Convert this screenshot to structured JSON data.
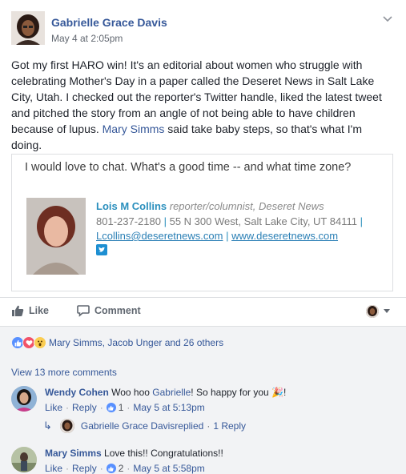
{
  "post": {
    "author": "Gabrielle Grace Davis",
    "timestamp": "May 4 at 2:05pm",
    "text_before_mention": "Got my first HARO win! It's an editorial about women who struggle with celebrating Mother's Day in a paper called the Deseret News in Salt Lake City, Utah. I checked out the reporter's Twitter handle, liked the latest tweet and pitched the story from an angle of not being able to have children because of lupus. ",
    "mention": "Mary Simms",
    "text_after_mention": " said take baby steps, so that's what I'm doing."
  },
  "embedded_image": {
    "message": "I would love to chat. What's a good time -- and what time zone?",
    "signature": {
      "name": "Lois M Collins",
      "role": "reporter/columnist, Deseret News",
      "phone": "801-237-2180",
      "sep1": "|",
      "address": "55 N 300 West, Salt Lake City, UT 84111",
      "sep2": "|",
      "email": "Lcollins@deseretnews.com",
      "sep3": "|",
      "website": "www.deseretnews.com"
    }
  },
  "actions": {
    "like_label": "Like",
    "comment_label": "Comment"
  },
  "reactions": {
    "summary": "Mary Simms, Jacob Unger and 26 others",
    "types": [
      "like",
      "love",
      "wow"
    ]
  },
  "view_more": "View 13 more comments",
  "comments": [
    {
      "name": "Wendy Cohen",
      "text_before": " Woo hoo ",
      "mention": "Gabrielle",
      "text_after": "! So happy for you ",
      "emoji": "🎉",
      "text_end": "!",
      "like": "Like",
      "reply": "Reply",
      "like_count": "1",
      "time": "May 5 at 5:13pm",
      "replies": {
        "author": "Gabrielle Grace Davis",
        "action": " replied",
        "count": "1 Reply"
      }
    },
    {
      "name": "Mary Simms",
      "text": " Love this!! Congratulations!!",
      "like": "Like",
      "reply": "Reply",
      "like_count": "2",
      "time": "May 5 at 5:58pm"
    }
  ],
  "separators": {
    "dot": "·"
  },
  "colors": {
    "link": "#365899",
    "like_blue": "#5890ff",
    "love_red": "#f25268",
    "wow_yellow": "#fbcd52"
  }
}
